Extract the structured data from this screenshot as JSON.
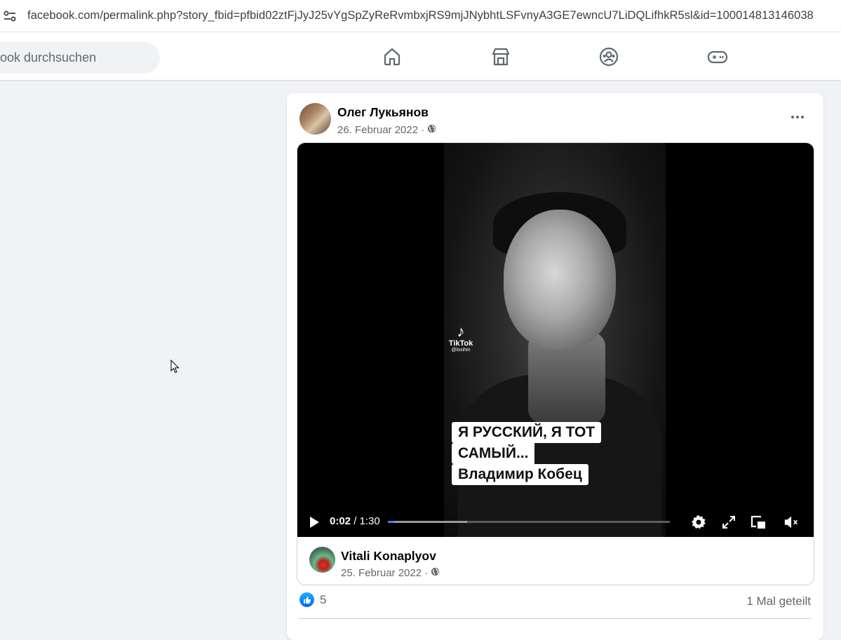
{
  "browser": {
    "url": "facebook.com/permalink.php?story_fbid=pfbid02ztFjJyJ25vYgSpZyReRvmbxjRS9mjJNybhtLSFvnyA3GE7ewncU7LiDQLifhkR5sl&id=100014813146038"
  },
  "nav": {
    "search_placeholder": "ook durchsuchen",
    "icons": [
      "home-icon",
      "marketplace-icon",
      "groups-icon",
      "gaming-icon"
    ]
  },
  "post": {
    "author": "Олег Лукьянов",
    "date": "26. Februar 2022 ·",
    "privacy_icon": "globe-icon",
    "video": {
      "watermark_brand": "TikTok",
      "watermark_handle": "@losihin",
      "caption_line1": "Я РУССКИЙ, Я ТОТ",
      "caption_line2": "САМЫЙ...",
      "caption_line3": "Владимир Кобец",
      "current_time": "0:02",
      "separator": " / ",
      "duration": "1:30",
      "progress_fraction": 0.022,
      "buffered_fraction": 0.28
    },
    "shared_from": {
      "author": "Vitali Konaplyov",
      "date": "25. Februar 2022 ·"
    },
    "like_count": "5",
    "shares": "1 Mal geteilt"
  },
  "colors": {
    "accent": "#0866ff",
    "progress": "#4d7de8",
    "page_bg": "#f0f2f5"
  }
}
